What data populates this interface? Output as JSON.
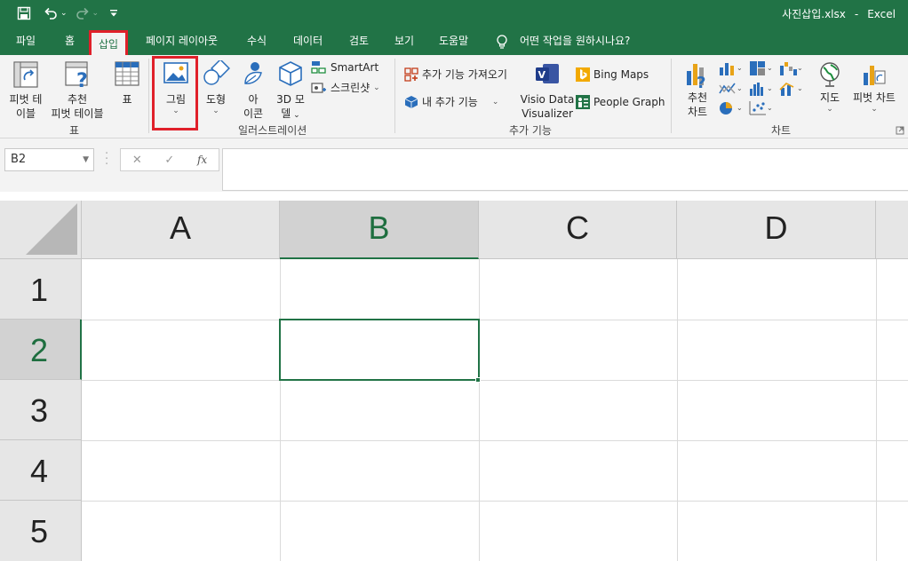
{
  "window": {
    "filename": "사진삽입.xlsx",
    "app": "Excel"
  },
  "qat": {
    "undo_chev": "⌄",
    "redo_chev": "⌄",
    "customize": "⌄"
  },
  "tabs": [
    {
      "label": "파일"
    },
    {
      "label": "홈"
    },
    {
      "label": "삽입",
      "active": true
    },
    {
      "label": "페이지 레이아웃"
    },
    {
      "label": "수식"
    },
    {
      "label": "데이터"
    },
    {
      "label": "검토"
    },
    {
      "label": "보기"
    },
    {
      "label": "도움말"
    }
  ],
  "tell_me": "어떤 작업을 원하시나요?",
  "ribbon": {
    "tables": {
      "group_label": "표",
      "pivot_line1": "피벗 테",
      "pivot_line2": "이블",
      "recommended_line1": "추천",
      "recommended_line2": "피벗 테이블",
      "table": "표"
    },
    "illustrations": {
      "group_label": "일러스트레이션",
      "pictures": "그림",
      "shapes": "도형",
      "icons_line1": "아",
      "icons_line2": "이콘",
      "models_line1": "3D 모",
      "models_line2": "델",
      "smartart": "SmartArt",
      "screenshot": "스크린샷"
    },
    "addins": {
      "group_label": "추가 기능",
      "get_addins": "추가 기능 가져오기",
      "my_addins": "내 추가 기능",
      "visio_line1": "Visio Data",
      "visio_line2": "Visualizer",
      "bing_maps": "Bing Maps",
      "people_graph": "People Graph"
    },
    "charts": {
      "group_label": "차트",
      "recommended_line1": "추천",
      "recommended_line2": "차트",
      "maps": "지도",
      "pivot_chart": "피벗 차트"
    }
  },
  "formula_bar": {
    "name_box": "B2",
    "cancel": "✕",
    "enter": "✓",
    "fx": "fx",
    "value": ""
  },
  "grid": {
    "columns": [
      "A",
      "B",
      "C",
      "D"
    ],
    "rows": [
      "1",
      "2",
      "3",
      "4",
      "5"
    ],
    "selected_cell": "B2"
  },
  "colors": {
    "accent": "#217346",
    "highlight": "#e0202a"
  }
}
